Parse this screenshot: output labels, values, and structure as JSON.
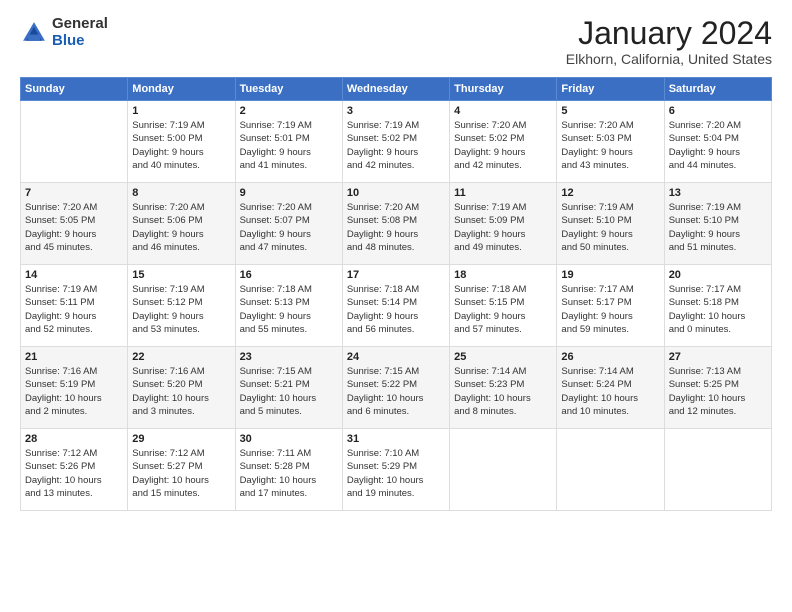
{
  "logo": {
    "general": "General",
    "blue": "Blue"
  },
  "header": {
    "title": "January 2024",
    "subtitle": "Elkhorn, California, United States"
  },
  "weekdays": [
    "Sunday",
    "Monday",
    "Tuesday",
    "Wednesday",
    "Thursday",
    "Friday",
    "Saturday"
  ],
  "weeks": [
    [
      {
        "day": "",
        "info": ""
      },
      {
        "day": "1",
        "info": "Sunrise: 7:19 AM\nSunset: 5:00 PM\nDaylight: 9 hours\nand 40 minutes."
      },
      {
        "day": "2",
        "info": "Sunrise: 7:19 AM\nSunset: 5:01 PM\nDaylight: 9 hours\nand 41 minutes."
      },
      {
        "day": "3",
        "info": "Sunrise: 7:19 AM\nSunset: 5:02 PM\nDaylight: 9 hours\nand 42 minutes."
      },
      {
        "day": "4",
        "info": "Sunrise: 7:20 AM\nSunset: 5:02 PM\nDaylight: 9 hours\nand 42 minutes."
      },
      {
        "day": "5",
        "info": "Sunrise: 7:20 AM\nSunset: 5:03 PM\nDaylight: 9 hours\nand 43 minutes."
      },
      {
        "day": "6",
        "info": "Sunrise: 7:20 AM\nSunset: 5:04 PM\nDaylight: 9 hours\nand 44 minutes."
      }
    ],
    [
      {
        "day": "7",
        "info": "Sunrise: 7:20 AM\nSunset: 5:05 PM\nDaylight: 9 hours\nand 45 minutes."
      },
      {
        "day": "8",
        "info": "Sunrise: 7:20 AM\nSunset: 5:06 PM\nDaylight: 9 hours\nand 46 minutes."
      },
      {
        "day": "9",
        "info": "Sunrise: 7:20 AM\nSunset: 5:07 PM\nDaylight: 9 hours\nand 47 minutes."
      },
      {
        "day": "10",
        "info": "Sunrise: 7:20 AM\nSunset: 5:08 PM\nDaylight: 9 hours\nand 48 minutes."
      },
      {
        "day": "11",
        "info": "Sunrise: 7:19 AM\nSunset: 5:09 PM\nDaylight: 9 hours\nand 49 minutes."
      },
      {
        "day": "12",
        "info": "Sunrise: 7:19 AM\nSunset: 5:10 PM\nDaylight: 9 hours\nand 50 minutes."
      },
      {
        "day": "13",
        "info": "Sunrise: 7:19 AM\nSunset: 5:10 PM\nDaylight: 9 hours\nand 51 minutes."
      }
    ],
    [
      {
        "day": "14",
        "info": "Sunrise: 7:19 AM\nSunset: 5:11 PM\nDaylight: 9 hours\nand 52 minutes."
      },
      {
        "day": "15",
        "info": "Sunrise: 7:19 AM\nSunset: 5:12 PM\nDaylight: 9 hours\nand 53 minutes."
      },
      {
        "day": "16",
        "info": "Sunrise: 7:18 AM\nSunset: 5:13 PM\nDaylight: 9 hours\nand 55 minutes."
      },
      {
        "day": "17",
        "info": "Sunrise: 7:18 AM\nSunset: 5:14 PM\nDaylight: 9 hours\nand 56 minutes."
      },
      {
        "day": "18",
        "info": "Sunrise: 7:18 AM\nSunset: 5:15 PM\nDaylight: 9 hours\nand 57 minutes."
      },
      {
        "day": "19",
        "info": "Sunrise: 7:17 AM\nSunset: 5:17 PM\nDaylight: 9 hours\nand 59 minutes."
      },
      {
        "day": "20",
        "info": "Sunrise: 7:17 AM\nSunset: 5:18 PM\nDaylight: 10 hours\nand 0 minutes."
      }
    ],
    [
      {
        "day": "21",
        "info": "Sunrise: 7:16 AM\nSunset: 5:19 PM\nDaylight: 10 hours\nand 2 minutes."
      },
      {
        "day": "22",
        "info": "Sunrise: 7:16 AM\nSunset: 5:20 PM\nDaylight: 10 hours\nand 3 minutes."
      },
      {
        "day": "23",
        "info": "Sunrise: 7:15 AM\nSunset: 5:21 PM\nDaylight: 10 hours\nand 5 minutes."
      },
      {
        "day": "24",
        "info": "Sunrise: 7:15 AM\nSunset: 5:22 PM\nDaylight: 10 hours\nand 6 minutes."
      },
      {
        "day": "25",
        "info": "Sunrise: 7:14 AM\nSunset: 5:23 PM\nDaylight: 10 hours\nand 8 minutes."
      },
      {
        "day": "26",
        "info": "Sunrise: 7:14 AM\nSunset: 5:24 PM\nDaylight: 10 hours\nand 10 minutes."
      },
      {
        "day": "27",
        "info": "Sunrise: 7:13 AM\nSunset: 5:25 PM\nDaylight: 10 hours\nand 12 minutes."
      }
    ],
    [
      {
        "day": "28",
        "info": "Sunrise: 7:12 AM\nSunset: 5:26 PM\nDaylight: 10 hours\nand 13 minutes."
      },
      {
        "day": "29",
        "info": "Sunrise: 7:12 AM\nSunset: 5:27 PM\nDaylight: 10 hours\nand 15 minutes."
      },
      {
        "day": "30",
        "info": "Sunrise: 7:11 AM\nSunset: 5:28 PM\nDaylight: 10 hours\nand 17 minutes."
      },
      {
        "day": "31",
        "info": "Sunrise: 7:10 AM\nSunset: 5:29 PM\nDaylight: 10 hours\nand 19 minutes."
      },
      {
        "day": "",
        "info": ""
      },
      {
        "day": "",
        "info": ""
      },
      {
        "day": "",
        "info": ""
      }
    ]
  ]
}
